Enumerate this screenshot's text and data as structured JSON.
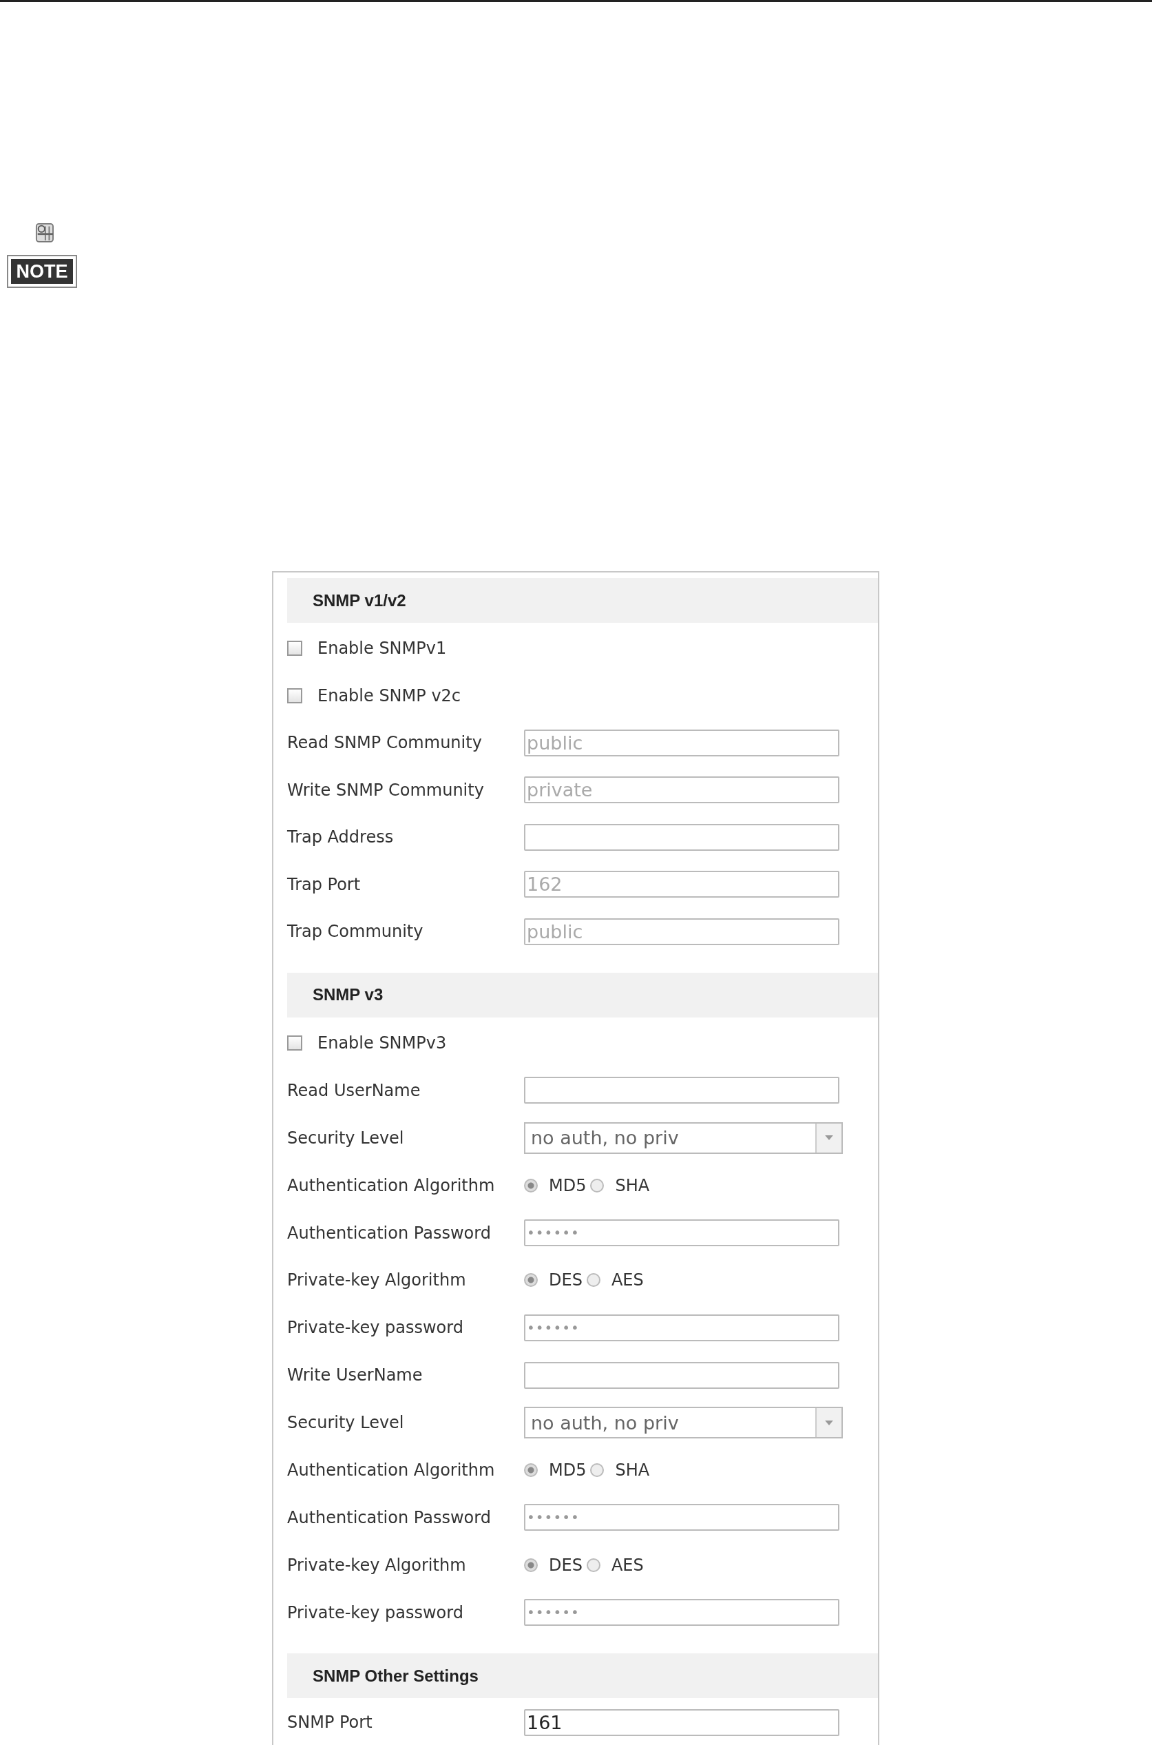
{
  "note": {
    "label": "NOTE"
  },
  "sections": [
    {
      "title": "SNMP v1/v2",
      "rows": [
        {
          "kind": "checkbox",
          "label": "Enable SNMPv1",
          "checked": false
        },
        {
          "kind": "checkbox",
          "label": "Enable SNMP v2c",
          "checked": false
        },
        {
          "kind": "text",
          "label": "Read SNMP Community",
          "value": "public",
          "disabled": true
        },
        {
          "kind": "text",
          "label": "Write SNMP Community",
          "value": "private",
          "disabled": true
        },
        {
          "kind": "text",
          "label": "Trap Address"
        },
        {
          "kind": "text",
          "label": "Trap Port",
          "value": "162",
          "disabled": true
        },
        {
          "kind": "text",
          "label": "Trap Community",
          "value": "public",
          "disabled": true
        }
      ]
    },
    {
      "title": "SNMP v3",
      "rows": [
        {
          "kind": "checkbox",
          "label": "Enable SNMPv3",
          "checked": false
        },
        {
          "kind": "text",
          "label": "Read UserName"
        },
        {
          "kind": "select",
          "label": "Security Level",
          "value": "no auth, no priv"
        },
        {
          "kind": "radio",
          "label": "Authentication Algorithm",
          "options": [
            {
              "label": "MD5",
              "selected": true
            },
            {
              "label": "SHA",
              "selected": false
            }
          ]
        },
        {
          "kind": "password",
          "label": "Authentication Password",
          "value": "••••••"
        },
        {
          "kind": "radio",
          "label": "Private-key Algorithm",
          "options": [
            {
              "label": "DES",
              "selected": true
            },
            {
              "label": "AES",
              "selected": false
            }
          ]
        },
        {
          "kind": "password",
          "label": "Private-key password",
          "value": "••••••"
        },
        {
          "kind": "text",
          "label": "Write UserName"
        },
        {
          "kind": "select",
          "label": "Security Level",
          "value": "no auth, no priv"
        },
        {
          "kind": "radio",
          "label": "Authentication Algorithm",
          "options": [
            {
              "label": "MD5",
              "selected": true
            },
            {
              "label": "SHA",
              "selected": false
            }
          ]
        },
        {
          "kind": "password",
          "label": "Authentication Password",
          "value": "••••••"
        },
        {
          "kind": "radio",
          "label": "Private-key Algorithm",
          "options": [
            {
              "label": "DES",
              "selected": true
            },
            {
              "label": "AES",
              "selected": false
            }
          ]
        },
        {
          "kind": "password",
          "label": "Private-key password",
          "value": "••••••"
        }
      ]
    },
    {
      "title": "SNMP Other Settings",
      "rows": [
        {
          "kind": "text",
          "label": "SNMP Port",
          "value": "161",
          "disabled": false
        }
      ]
    }
  ]
}
